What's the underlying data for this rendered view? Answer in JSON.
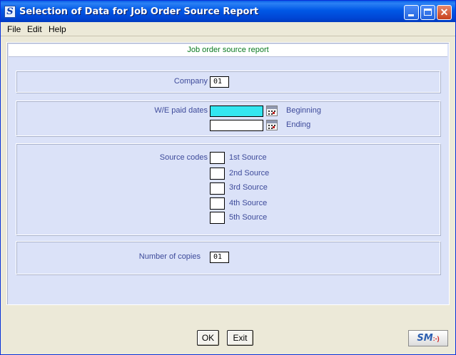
{
  "window": {
    "title": "Selection of Data for Job Order Source Report",
    "app_icon_letter": "S"
  },
  "menu": [
    "File",
    "Edit",
    "Help"
  ],
  "report_banner": "Job order source report",
  "company": {
    "label": "Company",
    "value": "01"
  },
  "we_paid_dates": {
    "label": "W/E paid dates",
    "beginning_label": "Beginning",
    "ending_label": "Ending",
    "beginning_value": "",
    "ending_value": ""
  },
  "source_codes": {
    "label": "Source codes",
    "items": [
      "1st Source",
      "2nd Source",
      "3rd Source",
      "4th Source",
      "5th Source"
    ]
  },
  "copies": {
    "label": "Number of copies",
    "value": "01"
  },
  "buttons": {
    "ok": "OK",
    "exit": "Exit"
  },
  "logo": {
    "text": "SM",
    "face": ":-)"
  },
  "colors": {
    "titlebar": "#0058e6",
    "client_bg": "#dbe2f8",
    "label_text": "#3d4a9a",
    "banner_text": "#0a7a20",
    "active_field": "#33e6f0"
  }
}
